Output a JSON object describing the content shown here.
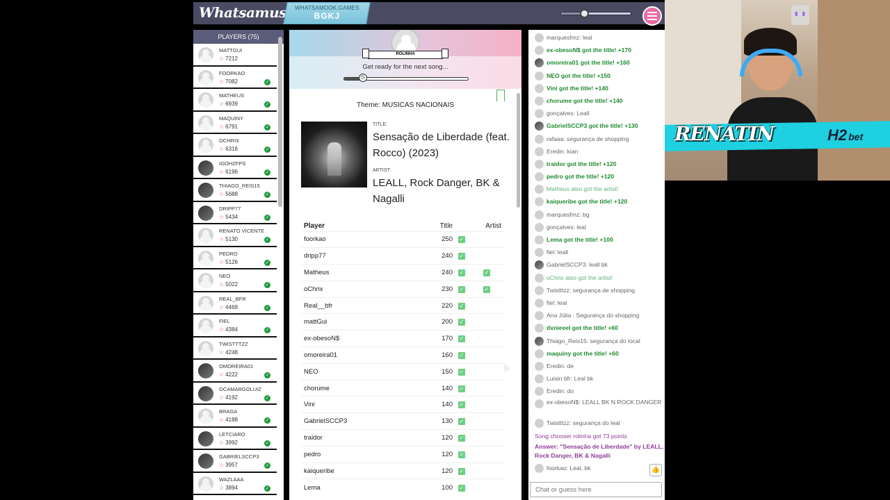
{
  "topbar": {
    "logo": "Whatsamusic",
    "room_site": "WHATSAMOOK.GAMES",
    "room_code": "BGKJ",
    "volume_level": 0.33
  },
  "players": {
    "header": "PLAYERS (75)",
    "list": [
      {
        "name": "MATTGUI",
        "score": "7212",
        "check": false,
        "photo": false
      },
      {
        "name": "FOORKAO",
        "score": "7082",
        "check": true,
        "photo": false
      },
      {
        "name": "MATHEUS",
        "score": "6939",
        "check": true,
        "photo": false
      },
      {
        "name": "MAQUINY",
        "score": "6791",
        "check": true,
        "photo": false
      },
      {
        "name": "OCHRIX",
        "score": "6316",
        "check": true,
        "photo": false
      },
      {
        "name": "IGOHZFPS",
        "score": "6196",
        "check": true,
        "photo": true
      },
      {
        "name": "THIAGO_REIS15",
        "score": "5688",
        "check": true,
        "photo": true
      },
      {
        "name": "DRIPP77",
        "score": "5434",
        "check": true,
        "photo": true
      },
      {
        "name": "RENATO VICENTE",
        "score": "5130",
        "check": true,
        "photo": false
      },
      {
        "name": "PEDRO",
        "score": "5126",
        "check": true,
        "photo": false
      },
      {
        "name": "NEO",
        "score": "5022",
        "check": true,
        "photo": false
      },
      {
        "name": "REAL_BFR",
        "score": "4468",
        "check": true,
        "photo": false
      },
      {
        "name": "FIEL",
        "score": "4384",
        "check": true,
        "photo": false
      },
      {
        "name": "TWISTTTZZ",
        "score": "4248",
        "check": false,
        "photo": false
      },
      {
        "name": "OMOREIRA01",
        "score": "4222",
        "check": true,
        "photo": true
      },
      {
        "name": "OCAMARGOLUIZ",
        "score": "4192",
        "check": true,
        "photo": true
      },
      {
        "name": "BRAGA",
        "score": "4188",
        "check": true,
        "photo": false
      },
      {
        "name": "LETCIARO",
        "score": "3992",
        "check": true,
        "photo": true
      },
      {
        "name": "GABRIELSCCP3",
        "score": "3957",
        "check": true,
        "photo": true
      },
      {
        "name": "WAZLAAA",
        "score": "3894",
        "check": true,
        "photo": false
      }
    ]
  },
  "song": {
    "chooser": "ROLINHA",
    "status": "Get ready for the next song...",
    "timer_progress": 0.15,
    "theme": "Theme: MUSICAS NACIONAIS",
    "title_label": "TITLE:",
    "title": "Sensação de Liberdade (feat. Rocco) (2023)",
    "artist_label": "ARTIST:",
    "artist": "LEALL, Rock Danger, BK & Nagalli"
  },
  "scores": {
    "headers": {
      "player": "Player",
      "title": "Title",
      "artist": "Artist"
    },
    "rows": [
      {
        "player": "foorkao",
        "points": "250",
        "title": true,
        "artist": false
      },
      {
        "player": "dripp77",
        "points": "240",
        "title": true,
        "artist": false
      },
      {
        "player": "Matheus",
        "points": "240",
        "title": true,
        "artist": true
      },
      {
        "player": "oChrix",
        "points": "230",
        "title": true,
        "artist": true
      },
      {
        "player": "Real__bfr",
        "points": "220",
        "title": true,
        "artist": false
      },
      {
        "player": "mattGui",
        "points": "200",
        "title": true,
        "artist": false
      },
      {
        "player": "ex-obesoN$",
        "points": "170",
        "title": true,
        "artist": false
      },
      {
        "player": "omoreira01",
        "points": "160",
        "title": true,
        "artist": false
      },
      {
        "player": "NEO",
        "points": "150",
        "title": true,
        "artist": false
      },
      {
        "player": "chorume",
        "points": "140",
        "title": true,
        "artist": false
      },
      {
        "player": "Vini",
        "points": "140",
        "title": true,
        "artist": false
      },
      {
        "player": "GabrielSCCP3",
        "points": "130",
        "title": true,
        "artist": false
      },
      {
        "player": "traidor",
        "points": "120",
        "title": true,
        "artist": false
      },
      {
        "player": "pedro",
        "points": "120",
        "title": true,
        "artist": false
      },
      {
        "player": "kaiqueribe",
        "points": "120",
        "title": true,
        "artist": false
      },
      {
        "player": "Lema",
        "points": "100",
        "title": true,
        "artist": false
      }
    ]
  },
  "chat": {
    "messages": [
      {
        "text": "marquesfmz: leal",
        "kind": "normal",
        "photo": false
      },
      {
        "text": "ex-obesoN$ got the title! +170",
        "kind": "gain",
        "photo": false
      },
      {
        "text": "omoreira01 got the title! +160",
        "kind": "gain",
        "photo": true
      },
      {
        "text": "NEO got the title! +150",
        "kind": "gain",
        "photo": false
      },
      {
        "text": "Vini got the title! +140",
        "kind": "gain",
        "photo": false
      },
      {
        "text": "chorume got the title! +140",
        "kind": "gain",
        "photo": false
      },
      {
        "text": "gonçalves: Leall",
        "kind": "normal",
        "photo": false
      },
      {
        "text": "GabrielSCCP3 got the title! +130",
        "kind": "gain",
        "photo": true
      },
      {
        "text": "rafaaa: segurança de shopping",
        "kind": "normal",
        "photo": false
      },
      {
        "text": "Eredin: kian",
        "kind": "normal",
        "photo": false
      },
      {
        "text": "traidor got the title! +120",
        "kind": "gain",
        "photo": false
      },
      {
        "text": "pedro got the title! +120",
        "kind": "gain",
        "photo": false
      },
      {
        "text": "Matheus also got the artist!",
        "kind": "artist",
        "photo": false
      },
      {
        "text": "kaiqueribe got the title! +120",
        "kind": "gain",
        "photo": false
      },
      {
        "text": "marquesfmz: bg",
        "kind": "normal",
        "photo": false
      },
      {
        "text": "gonçalves: leal",
        "kind": "normal",
        "photo": false
      },
      {
        "text": "Lema got the title! +100",
        "kind": "gain",
        "photo": false
      },
      {
        "text": "fiel: leall",
        "kind": "normal",
        "photo": false
      },
      {
        "text": "GabrielSCCP3: leall bk",
        "kind": "normal",
        "photo": true
      },
      {
        "text": "oChrix also got the artist!",
        "kind": "artist",
        "photo": false
      },
      {
        "text": "Twistttzz: segurança de shopping",
        "kind": "normal",
        "photo": false
      },
      {
        "text": "fiel: leal",
        "kind": "normal",
        "photo": false
      },
      {
        "text": "Ana Júlia : Segurança do shopping",
        "kind": "normal",
        "photo": false
      },
      {
        "text": "dxnieeel got the title! +60",
        "kind": "gain",
        "photo": false
      },
      {
        "text": "Thiago_Reis15: segurança do local",
        "kind": "normal",
        "photo": true
      },
      {
        "text": "maquiny got the title! +60",
        "kind": "gain",
        "photo": false
      },
      {
        "text": "Eredin: de",
        "kind": "normal",
        "photo": false
      },
      {
        "text": "Luisin bfr: Leal bk",
        "kind": "normal",
        "photo": false
      },
      {
        "text": "Eredin: do",
        "kind": "normal",
        "photo": false
      },
      {
        "text": "ex-obesoN$: LEALL BK N ROCK DANGER",
        "kind": "multi",
        "photo": false
      },
      {
        "text": "Twistttzz: segurança do leal",
        "kind": "normal",
        "photo": false
      },
      {
        "text": "Song chooser rolinha got 73 points",
        "kind": "system",
        "photo": false
      },
      {
        "text": "Answer: \"Sensação de Liberdade\" by LEALL, Rock Danger, BK & Nagalli",
        "kind": "answer",
        "photo": false
      },
      {
        "text": "foorkao: Leal, bk",
        "kind": "normal",
        "photo": false
      }
    ],
    "input_placeholder": "Chat or guess here"
  },
  "stream": {
    "brand": "RENATIN",
    "sponsor_main": "H2",
    "sponsor_sub": "bet"
  }
}
